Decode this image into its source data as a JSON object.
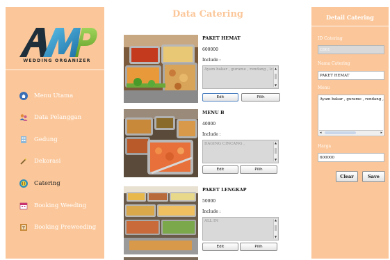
{
  "sidebar": {
    "logo_text": "WEDDING ORGANIZER",
    "items": [
      {
        "label": "Menu Utama",
        "icon": "home-icon"
      },
      {
        "label": "Data Pelanggan",
        "icon": "users-icon"
      },
      {
        "label": "Gedung",
        "icon": "building-icon"
      },
      {
        "label": "Dekorasi",
        "icon": "wand-icon"
      },
      {
        "label": "Catering",
        "icon": "catering-icon",
        "active": true
      },
      {
        "label": "Booking Weeding",
        "icon": "calendar-icon"
      },
      {
        "label": "Booking Preweeding",
        "icon": "frame-icon"
      }
    ]
  },
  "main": {
    "title": "Data Catering",
    "cards": [
      {
        "name": "PAKET HEMAT",
        "price": "600000",
        "include_label": "Include :",
        "include_text": "Ayam bakar , gurame , rendang , lontong",
        "edit_label": "Edit",
        "pilih_label": "Pilih"
      },
      {
        "name": "MENU B",
        "price": "40000",
        "include_label": "Include :",
        "include_text": "DAGING CINCANG ,",
        "edit_label": "Edit",
        "pilih_label": "Pilih"
      },
      {
        "name": "PAKET LENGKAP",
        "price": "50000",
        "include_label": "Include :",
        "include_text": "ALL IN",
        "edit_label": "Edit",
        "pilih_label": "Pilih"
      }
    ]
  },
  "detail": {
    "title": "Detail Catering",
    "id_label": "ID Catering",
    "id_value": "C001",
    "name_label": "Nama Catering",
    "name_value": "PAKET HEMAT",
    "menu_label": "Menu",
    "menu_value": "Ayam bakar , gurame , rendang , lontong",
    "price_label": "Harga",
    "price_value": "600000",
    "clear_label": "Clear",
    "save_label": "Save"
  },
  "colors": {
    "panel": "#fbc79a",
    "logo_blue": "#1d7fb8",
    "logo_green": "#7fb839",
    "logo_dark": "#1e2e3a"
  }
}
